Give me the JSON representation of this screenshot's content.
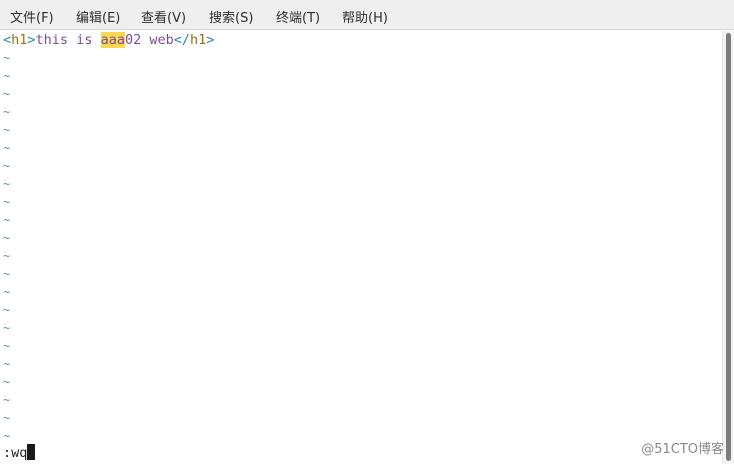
{
  "menubar": {
    "items": [
      {
        "label": "文件(F)"
      },
      {
        "label": "编辑(E)"
      },
      {
        "label": "查看(V)"
      },
      {
        "label": "搜索(S)"
      },
      {
        "label": "终端(T)"
      },
      {
        "label": "帮助(H)"
      }
    ]
  },
  "editor": {
    "line1": {
      "open_bracket": "<",
      "open_tag": "h1",
      "close_bracket": ">",
      "text_before": "this is ",
      "highlight": "aaa",
      "text_after": "02 web",
      "end_open_bracket": "</",
      "end_tag": "h1",
      "end_close_bracket": ">"
    },
    "empty_line_marker": "~",
    "command": ":wq"
  },
  "colors": {
    "tag_bracket": "#1c8f9f",
    "tag_name": "#a46b0c",
    "text": "#7a4d9a",
    "search_highlight": "#f7d84e",
    "tilde": "#5f8fa8"
  },
  "watermark": "@51CTO博客"
}
